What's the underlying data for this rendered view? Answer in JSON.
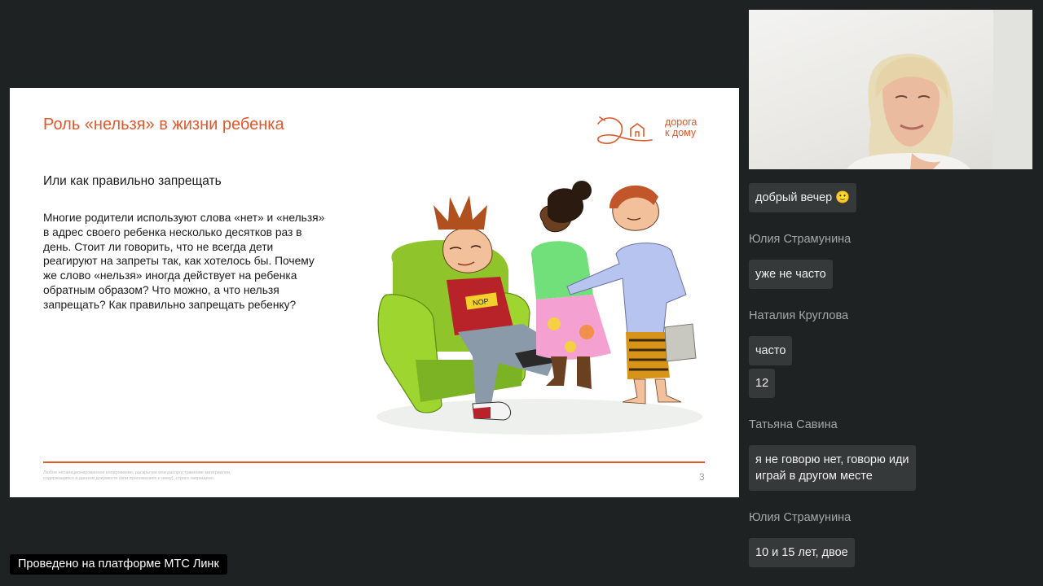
{
  "slide": {
    "title": "Роль «нельзя» в жизни ребенка",
    "logo_line1": "дорога",
    "logo_line2": "к дому",
    "subtitle": "Или как правильно запрещать",
    "body": "Многие родители используют слова «нет» и «нельзя» в адрес своего ребенка несколько десятков раз в день. Стоит ли говорить, что не всегда дети реагируют на запреты так, как хотелось бы. Почему же слово «нельзя» иногда действует на ребенка обратным образом? Что можно, а что нельзя запрещать? Как правильно запрещать ребенку?",
    "footer": "Любое несанкционированное копирование, раскрытие или распространение материалов, содержащихся в данном документе (или приложениях к нему), строго запрещено.",
    "page_number": "3",
    "shirt_text": "NOP",
    "accent_color": "#e0582a"
  },
  "chat": {
    "messages": [
      {
        "author": "",
        "text": "добрый вечер 🙂"
      },
      {
        "author": "Юлия Страмунина",
        "text": "уже не часто"
      },
      {
        "author": "Наталия Круглова",
        "text": "часто"
      },
      {
        "author": "",
        "text": "12"
      },
      {
        "author": "Татьяна Савина",
        "text": "я не говорю нет, говорю иди\nиграй в другом месте"
      },
      {
        "author": "Юлия Страмунина",
        "text": "10 и 15 лет, двое"
      }
    ]
  },
  "platform_badge": "Проведено на платформе МТС Линк"
}
